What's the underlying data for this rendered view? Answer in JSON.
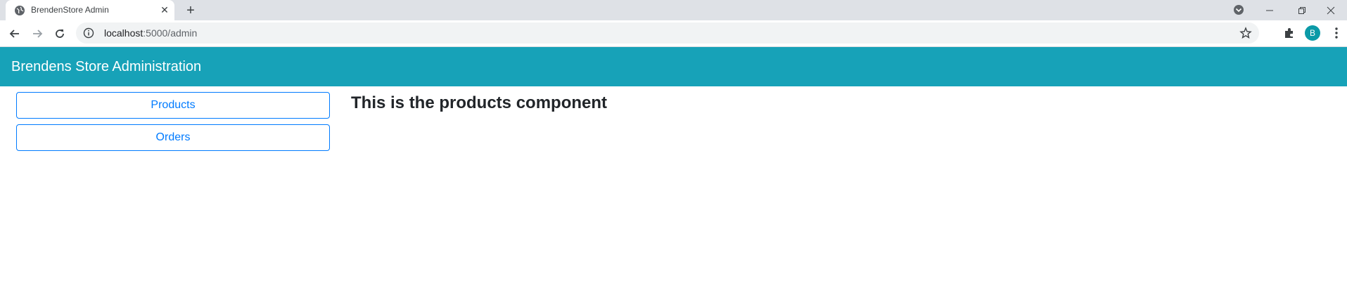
{
  "browser": {
    "tab": {
      "title": "BrendenStore Admin"
    },
    "omnibox": {
      "host": "localhost",
      "path": ":5000/admin"
    },
    "profile_initial": "B",
    "icons": {
      "favicon": "globe-icon",
      "close": "close-icon",
      "new_tab": "plus-icon",
      "back": "arrow-left-icon",
      "forward": "arrow-right-icon",
      "reload": "reload-icon",
      "info": "info-icon",
      "star": "star-icon",
      "extensions": "puzzle-icon",
      "menu": "kebab-menu-icon"
    }
  },
  "app": {
    "brand": "Brendens Store Administration",
    "nav": [
      {
        "label": "Products"
      },
      {
        "label": "Orders"
      }
    ],
    "content": {
      "heading": "This is the products component"
    },
    "colors": {
      "navbar": "#17a2b8",
      "link": "#007bff"
    }
  }
}
